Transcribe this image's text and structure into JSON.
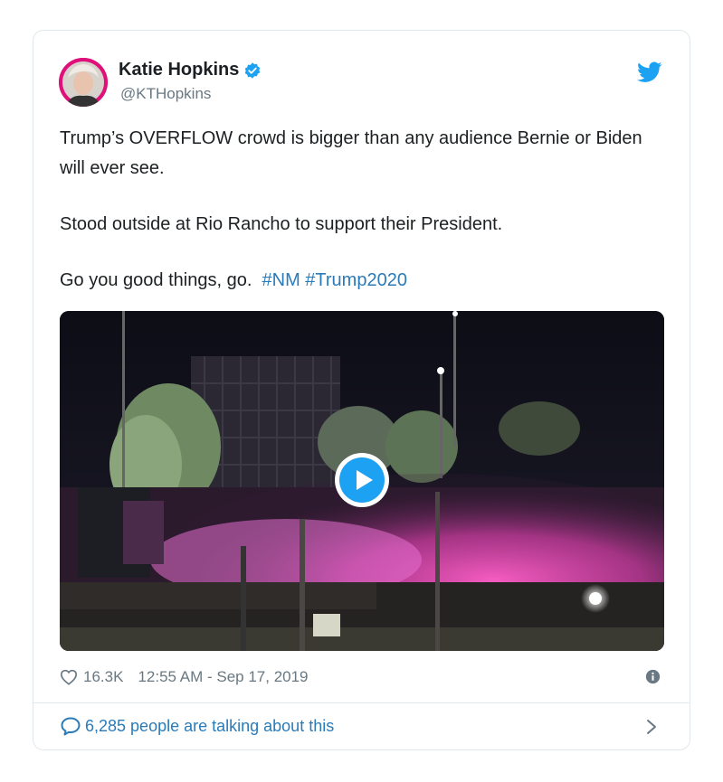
{
  "author": {
    "display_name": "Katie Hopkins",
    "handle": "@KTHopkins",
    "verified": true,
    "avatar_icon": "profile-photo"
  },
  "tweet": {
    "line1": "Trump’s OVERFLOW crowd is bigger than any audience Bernie or Biden will ever see.",
    "line2": "Stood outside at Rio Rancho to support their President.",
    "line3_text": "Go you good things, go.",
    "hashtags": [
      "#NM",
      "#Trump2020"
    ]
  },
  "media": {
    "type": "video",
    "icon": "play-icon"
  },
  "meta": {
    "likes": "16.3K",
    "timestamp": "12:55 AM - Sep 17, 2019",
    "info_icon": "info-icon"
  },
  "footer": {
    "talking_label": "6,285 people are talking about this",
    "icon": "comment-bubble-icon"
  },
  "colors": {
    "link": "#2b7bb9",
    "brand": "#1da1f2",
    "muted": "#697882",
    "border": "#e1e8ed",
    "text": "#1c2022"
  }
}
